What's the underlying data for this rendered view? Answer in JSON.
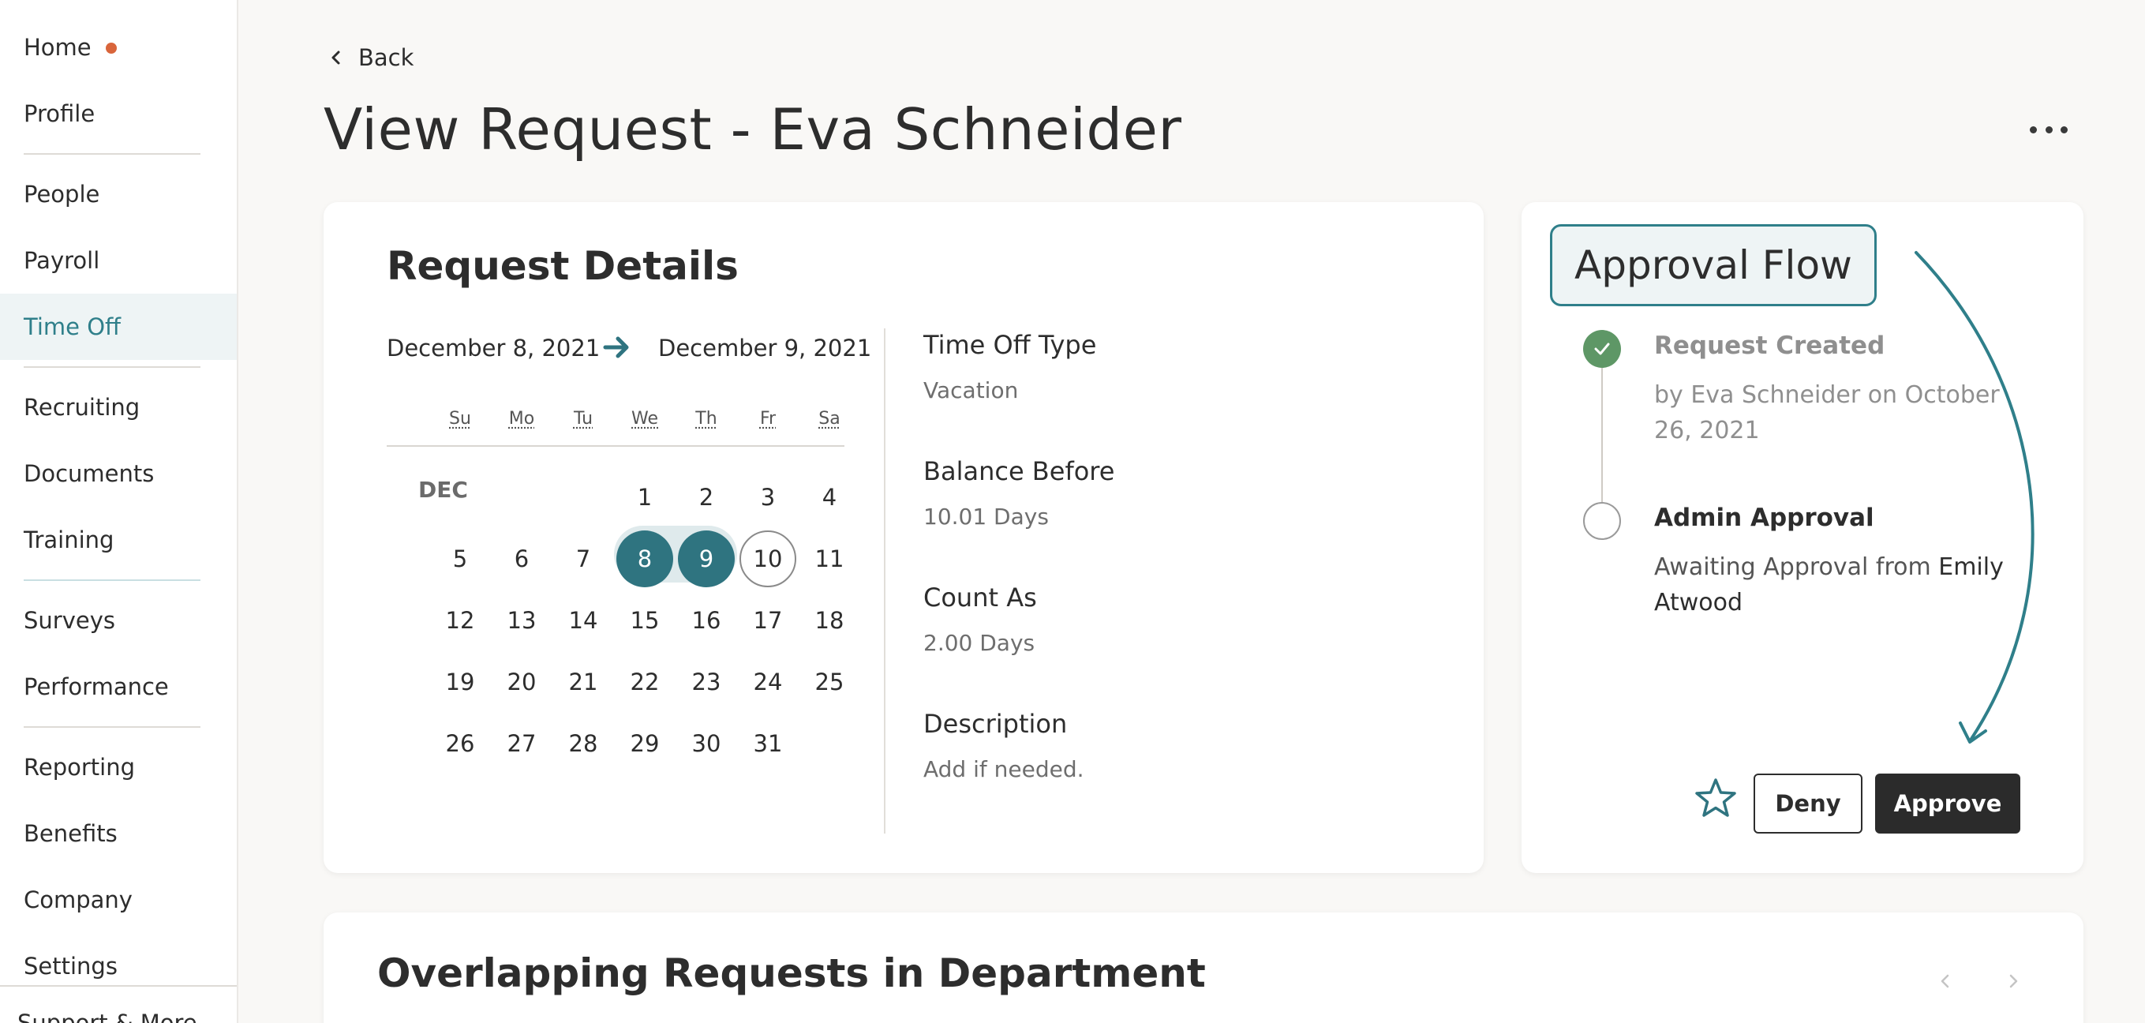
{
  "sidebar": {
    "items": [
      {
        "label": "Home"
      },
      {
        "label": "Profile"
      },
      {
        "label": "People"
      },
      {
        "label": "Payroll"
      },
      {
        "label": "Time Off"
      },
      {
        "label": "Recruiting"
      },
      {
        "label": "Documents"
      },
      {
        "label": "Training"
      },
      {
        "label": "Surveys"
      },
      {
        "label": "Performance"
      },
      {
        "label": "Reporting"
      },
      {
        "label": "Benefits"
      },
      {
        "label": "Company"
      },
      {
        "label": "Settings"
      },
      {
        "label": "Support & More"
      }
    ],
    "active": "Time Off"
  },
  "header": {
    "back_label": "Back",
    "title": "View Request - Eva Schneider"
  },
  "details": {
    "title": "Request Details",
    "date_from": "December 8, 2021",
    "date_to": "December 9, 2021",
    "calendar": {
      "month": "DEC",
      "weekdays": [
        "Su",
        "Mo",
        "Tu",
        "We",
        "Th",
        "Fr",
        "Sa"
      ],
      "days": [
        "1",
        "2",
        "3",
        "4",
        "5",
        "6",
        "7",
        "8",
        "9",
        "10",
        "11",
        "12",
        "13",
        "14",
        "15",
        "16",
        "17",
        "18",
        "19",
        "20",
        "21",
        "22",
        "23",
        "24",
        "25",
        "26",
        "27",
        "28",
        "29",
        "30",
        "31"
      ],
      "selected": [
        "8",
        "9"
      ],
      "today": "10"
    },
    "fields": {
      "type_label": "Time Off Type",
      "type_value": "Vacation",
      "balance_label": "Balance Before",
      "balance_value": "10.01 Days",
      "count_label": "Count As",
      "count_value": "2.00 Days",
      "desc_label": "Description",
      "desc_value": "Add if needed."
    }
  },
  "approval": {
    "title": "Approval Flow",
    "steps": [
      {
        "title": "Request Created",
        "desc": "by Eva Schneider on October 26, 2021"
      },
      {
        "title": "Admin Approval",
        "desc_prefix": "Awaiting Approval from ",
        "desc_name": "Emily Atwood"
      }
    ],
    "deny_label": "Deny",
    "approve_label": "Approve"
  },
  "overlap": {
    "title": "Overlapping Requests in Department"
  },
  "colors": {
    "accent": "#2f7480",
    "home_dot": "#d9653b",
    "check": "#5e9766"
  }
}
